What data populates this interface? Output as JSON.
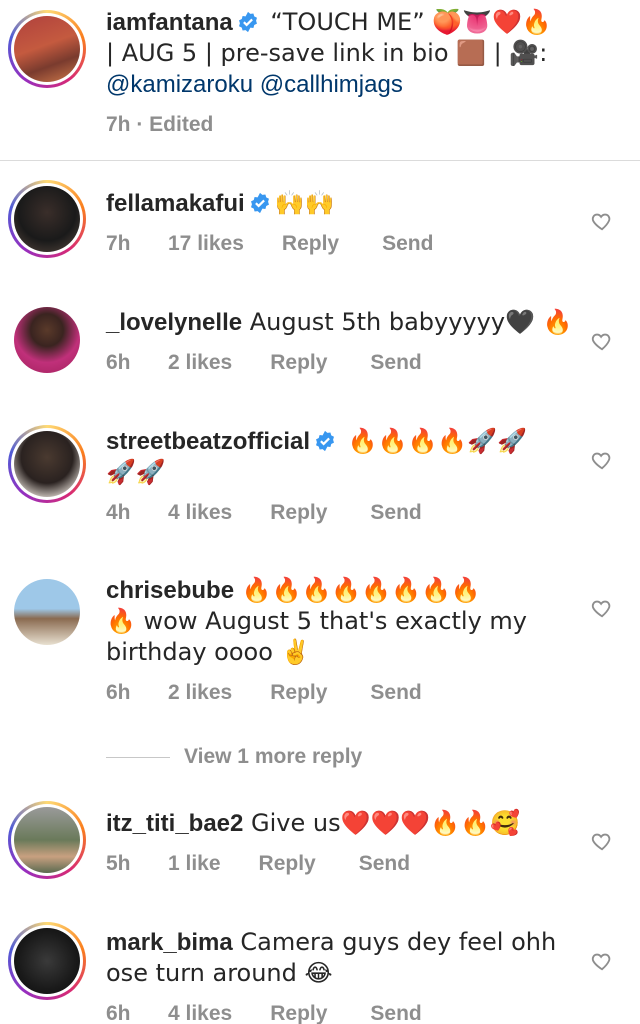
{
  "caption": {
    "username": "iamfantana",
    "text_line1": " “TOUCH ME” 🍑👅❤️🔥",
    "text_line2": "| AUG 5 | pre-save link in bio  🟫 | 🎥:",
    "mention1": "@kamizaroku",
    "mention2": "@callhimjags",
    "meta": "7h · Edited"
  },
  "comments": [
    {
      "username": "fellamakafui",
      "verified": true,
      "text": "🙌🙌",
      "time": "7h",
      "likes": "17 likes",
      "reply": "Reply",
      "send": "Send"
    },
    {
      "username": "_lovelynelle",
      "verified": false,
      "text": " August 5th babyyyyy🖤 🔥",
      "time": "6h",
      "likes": "2 likes",
      "reply": "Reply",
      "send": "Send"
    },
    {
      "username": "streetbeatzofficial",
      "verified": true,
      "text": " 🔥🔥🔥🔥🚀🚀",
      "text_line2": "🚀🚀",
      "time": "4h",
      "likes": "4 likes",
      "reply": "Reply",
      "send": "Send"
    },
    {
      "username": "chrisebube",
      "verified": false,
      "text": " 🔥🔥🔥🔥🔥🔥🔥🔥",
      "text_line2": "🔥 wow August 5 that's exactly my",
      "text_line3": "birthday oooo ✌️",
      "time": "6h",
      "likes": "2 likes",
      "reply": "Reply",
      "send": "Send"
    },
    {
      "username": "itz_titi_bae2",
      "verified": false,
      "text": " Give us❤️❤️❤️🔥🔥🥰",
      "time": "5h",
      "likes": "1 like",
      "reply": "Reply",
      "send": "Send"
    },
    {
      "username": "mark_bima",
      "verified": false,
      "text": " Camera guys dey feel ohh",
      "text_line2": "ose turn around 😂",
      "time": "6h",
      "likes": "4 likes",
      "reply": "Reply",
      "send": "Send"
    }
  ],
  "view_more_replies": "View 1 more reply",
  "colors": {
    "text": "#262626",
    "meta": "#8e8e8e",
    "mention": "#00376b",
    "verified": "#3897f0"
  }
}
